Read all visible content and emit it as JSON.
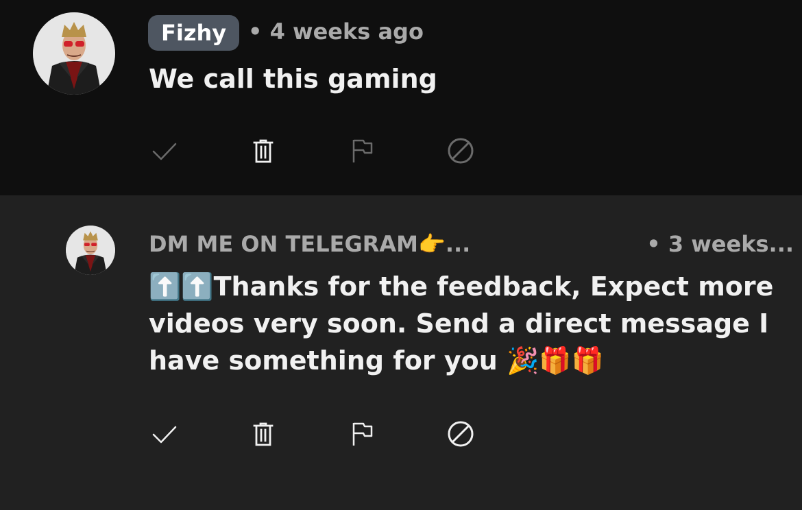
{
  "colors": {
    "dim_icon": "#6b6b6b",
    "bright_icon": "#f1f1f1",
    "meta_text": "#aaaaaa",
    "chip_bg": "#4e5661"
  },
  "comments": [
    {
      "author": "Fizhy",
      "time": "• 4 weeks ago",
      "text": "We call this gaming",
      "actions": [
        {
          "name": "check-icon",
          "label": "approve"
        },
        {
          "name": "trash-icon",
          "label": "remove"
        },
        {
          "name": "flag-icon",
          "label": "report"
        },
        {
          "name": "block-icon",
          "label": "hide user"
        }
      ]
    },
    {
      "author": "DM ME ON TELEGRAM👉...",
      "time": "• 3 weeks...",
      "text": "⬆️⬆️Thanks for the feedback, Expect more videos very soon. Send a direct message I have something for you 🎉🎁🎁",
      "actions": [
        {
          "name": "check-icon",
          "label": "approve"
        },
        {
          "name": "trash-icon",
          "label": "remove"
        },
        {
          "name": "flag-icon",
          "label": "report"
        },
        {
          "name": "block-icon",
          "label": "hide user"
        }
      ]
    }
  ]
}
